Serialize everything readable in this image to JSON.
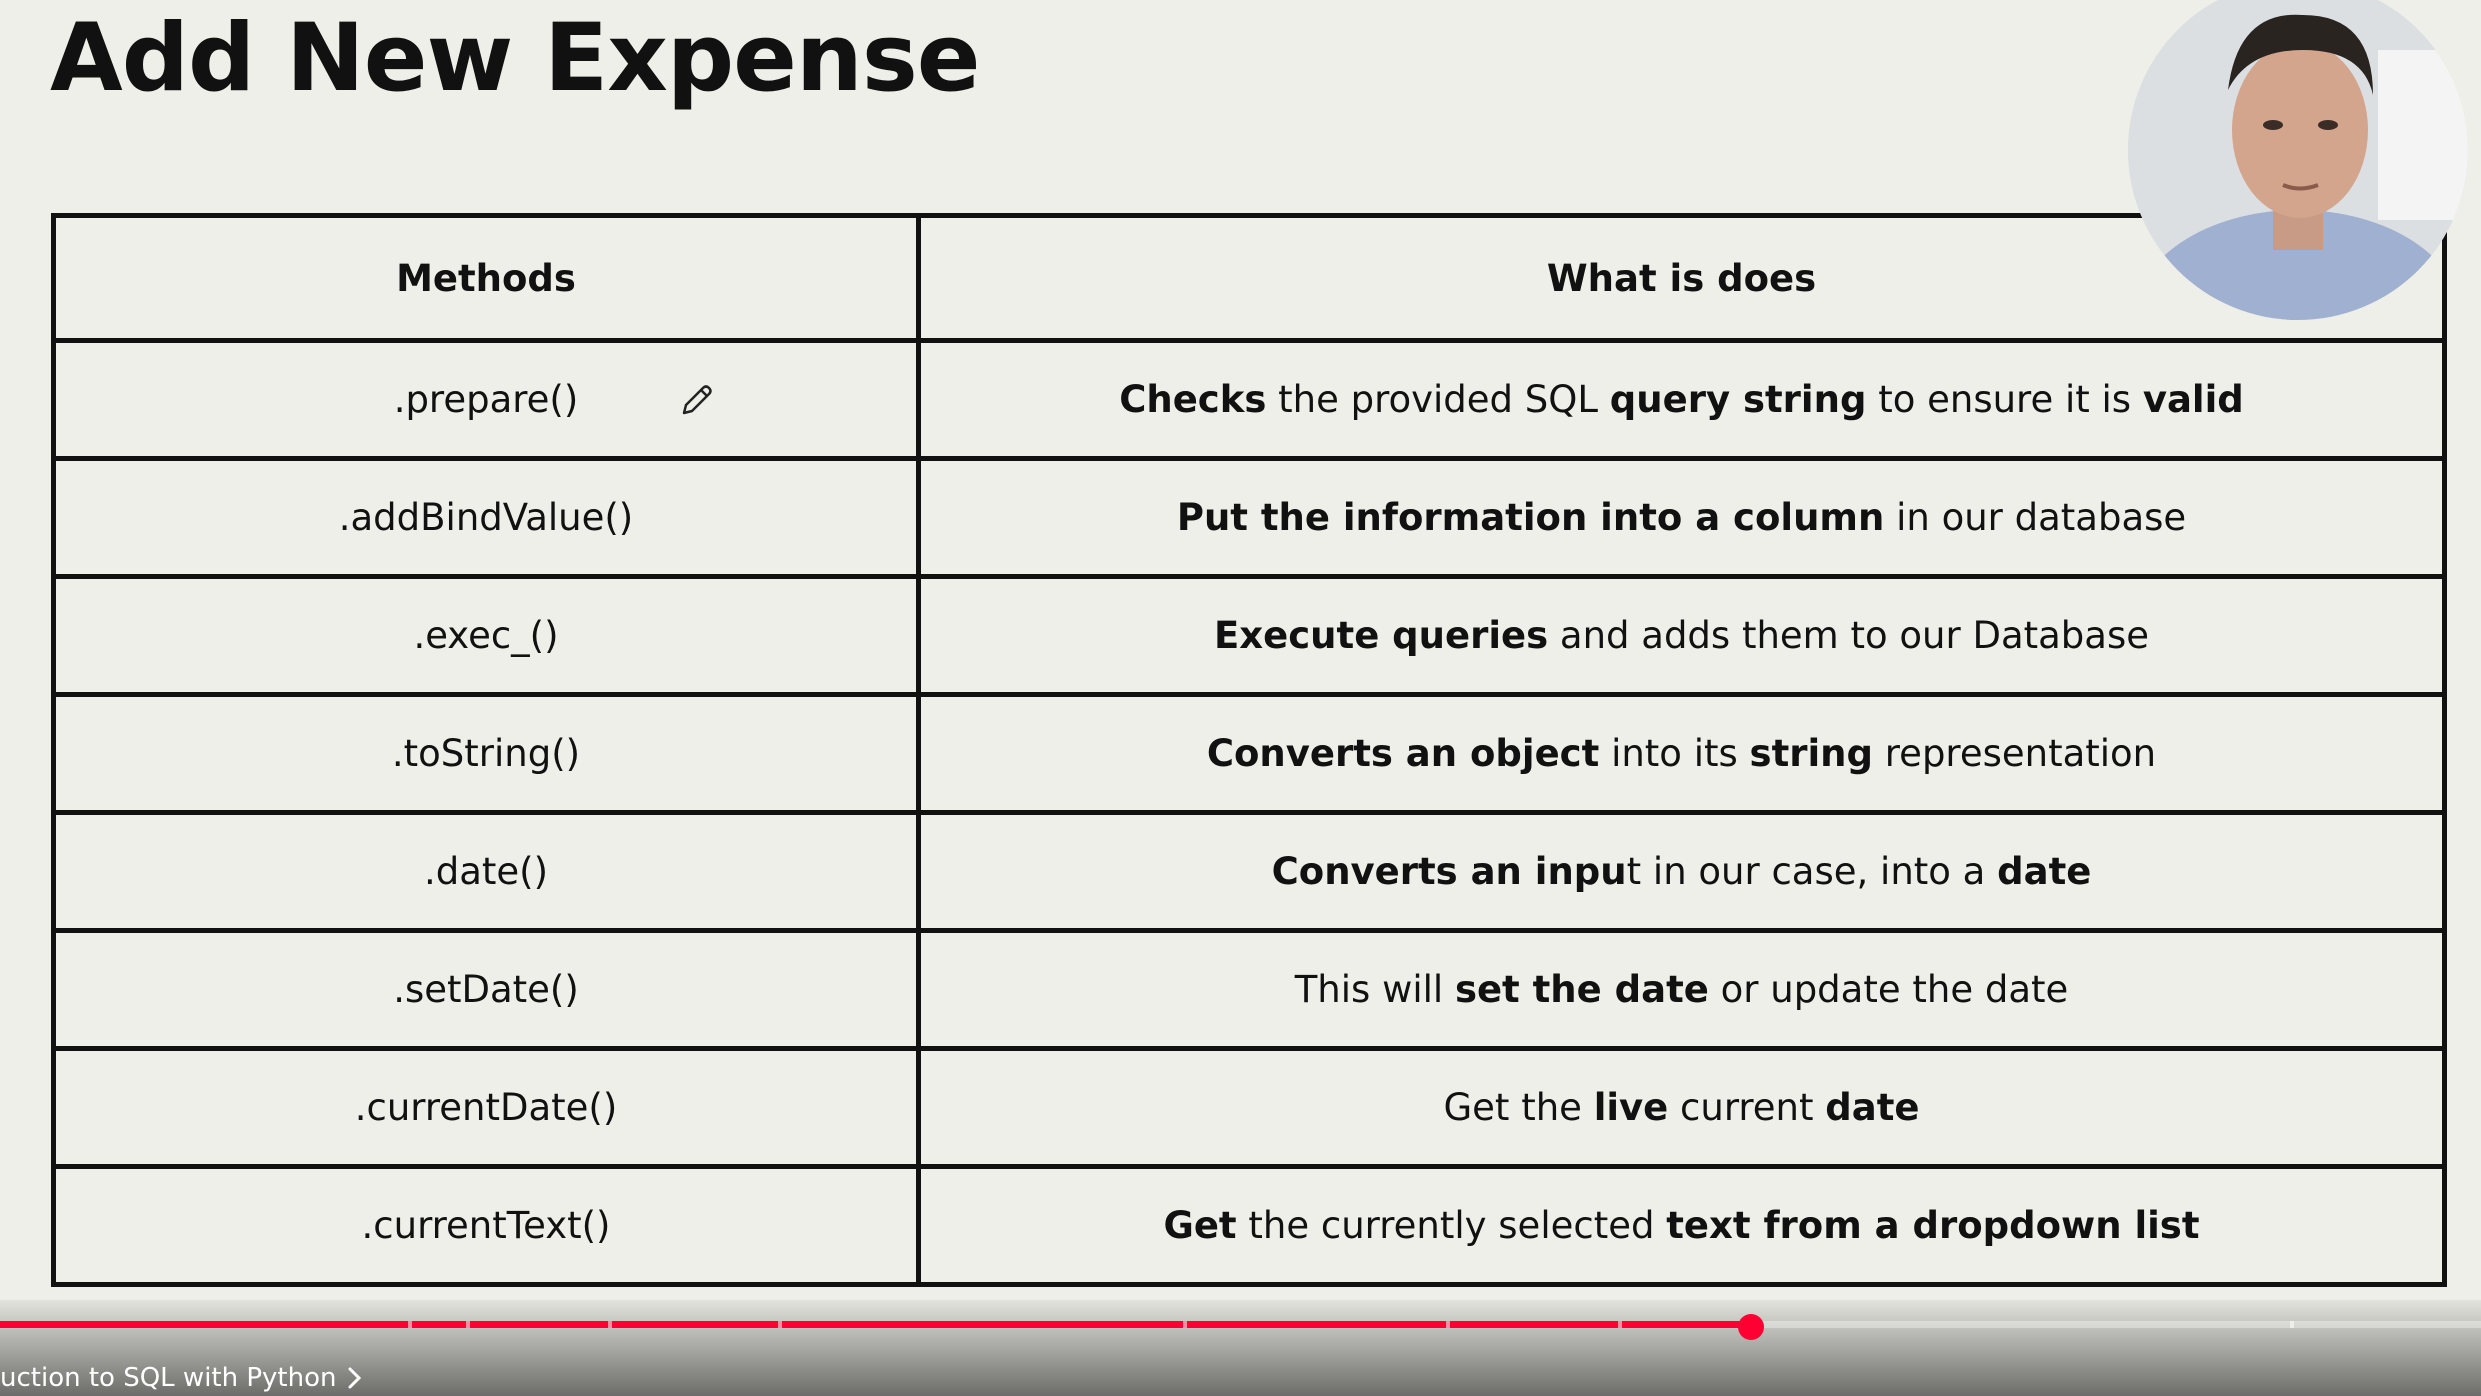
{
  "slide": {
    "title": "Add New Expense"
  },
  "table": {
    "headers": [
      "Methods",
      "What is does"
    ],
    "rows": [
      {
        "method": ".prepare()",
        "description": [
          {
            "t": "Checks",
            "b": true
          },
          {
            "t": " the provided SQL ",
            "b": false
          },
          {
            "t": "query string",
            "b": true
          },
          {
            "t": " to ensure it is ",
            "b": false
          },
          {
            "t": "valid",
            "b": true
          }
        ]
      },
      {
        "method": ".addBindValue()",
        "description": [
          {
            "t": "Put the information into a column",
            "b": true
          },
          {
            "t": " in our database",
            "b": false
          }
        ]
      },
      {
        "method": ".exec_()",
        "description": [
          {
            "t": "Execute queries",
            "b": true
          },
          {
            "t": " and adds them to our Database",
            "b": false
          }
        ]
      },
      {
        "method": ".toString()",
        "description": [
          {
            "t": "Converts an object",
            "b": true
          },
          {
            "t": " into its ",
            "b": false
          },
          {
            "t": "string",
            "b": true
          },
          {
            "t": " representation",
            "b": false
          }
        ]
      },
      {
        "method": ".date()",
        "description": [
          {
            "t": "Converts an inpu",
            "b": true
          },
          {
            "t": "t in our case, into a ",
            "b": false
          },
          {
            "t": "date",
            "b": true
          }
        ]
      },
      {
        "method": ".setDate()",
        "description": [
          {
            "t": "This will ",
            "b": false
          },
          {
            "t": "set the date",
            "b": true
          },
          {
            "t": " or update the date",
            "b": false
          }
        ]
      },
      {
        "method": ".currentDate()",
        "description": [
          {
            "t": "Get the ",
            "b": false
          },
          {
            "t": "live",
            "b": true
          },
          {
            "t": " current ",
            "b": false
          },
          {
            "t": "date",
            "b": true
          }
        ]
      },
      {
        "method": ".currentText()",
        "description": [
          {
            "t": "Get",
            "b": true
          },
          {
            "t": " the currently selected ",
            "b": false
          },
          {
            "t": "text from a dropdown list",
            "b": true
          }
        ]
      }
    ]
  },
  "player": {
    "progress_fraction": 0.706,
    "chapter_title": "uction to SQL with Python",
    "icons": [
      "pencil-icon",
      "chevron-right-icon"
    ],
    "accent_color": "#ff0033"
  }
}
